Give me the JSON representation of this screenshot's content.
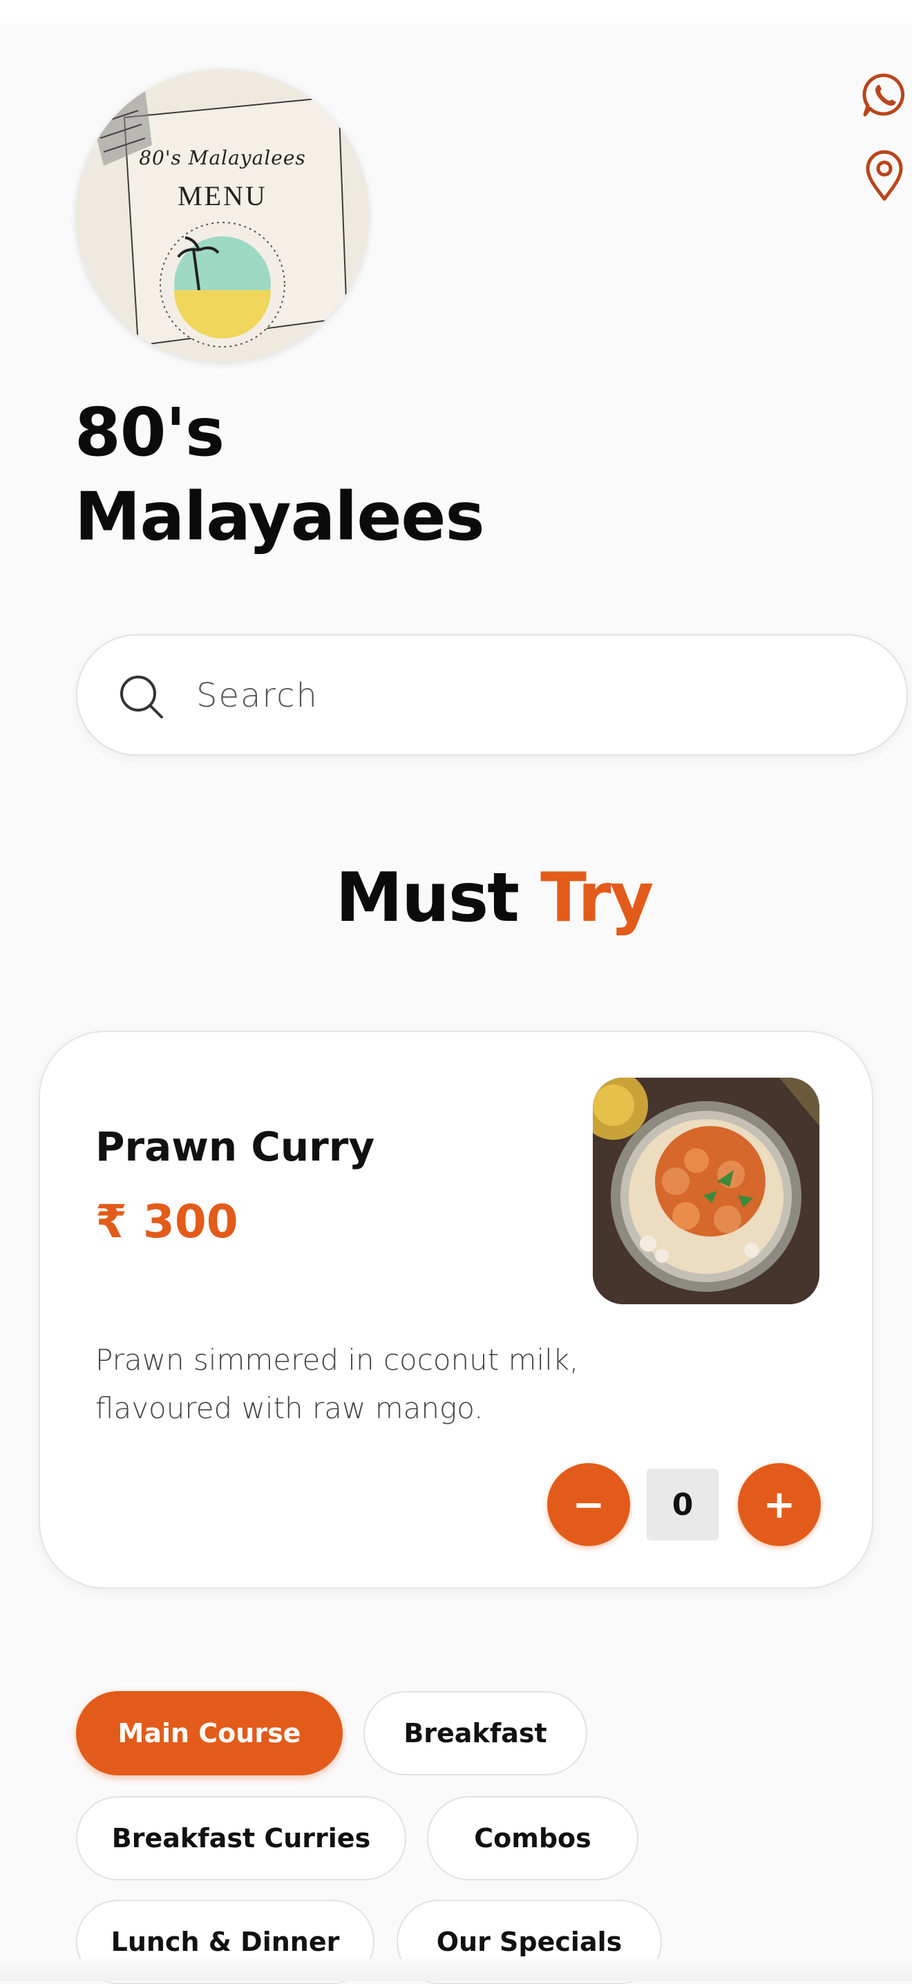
{
  "header": {
    "restaurant_name": "80's Malayalees",
    "logo": {
      "script_text": "80's Malayalees",
      "menu_text": "MENU"
    },
    "icons": [
      "whatsapp-icon",
      "location-pin-icon"
    ]
  },
  "search": {
    "placeholder": "Search",
    "value": ""
  },
  "must_try": {
    "title_plain": "Must",
    "title_accent": "Try"
  },
  "featured_item": {
    "name": "Prawn Curry",
    "price": "₹ 300",
    "description": "Prawn simmered in coconut milk, flavoured with raw mango.",
    "quantity": "0",
    "minus_label": "−",
    "plus_label": "+"
  },
  "categories": [
    {
      "label": "Main Course",
      "active": true
    },
    {
      "label": "Breakfast",
      "active": false
    },
    {
      "label": "Breakfast Curries",
      "active": false
    },
    {
      "label": "Combos",
      "active": false
    },
    {
      "label": "Lunch & Dinner",
      "active": false
    },
    {
      "label": "Our Specials",
      "active": false
    }
  ],
  "colors": {
    "accent": "#e35b1a",
    "text": "#111111",
    "background": "#fafafa"
  }
}
